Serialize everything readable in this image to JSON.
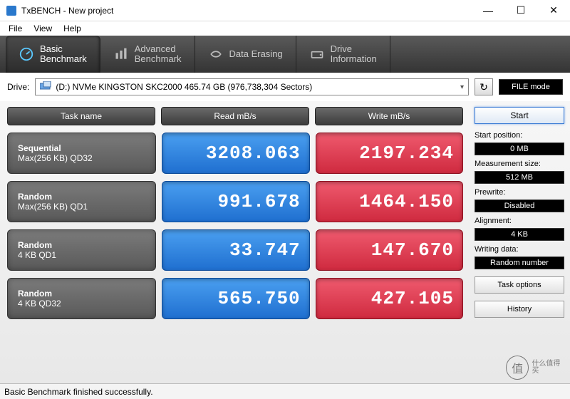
{
  "window": {
    "title": "TxBENCH - New project"
  },
  "menu": {
    "file": "File",
    "view": "View",
    "help": "Help"
  },
  "tabs": [
    {
      "label": "Basic\nBenchmark",
      "active": true
    },
    {
      "label": "Advanced\nBenchmark",
      "active": false
    },
    {
      "label": "Data Erasing",
      "active": false
    },
    {
      "label": "Drive\nInformation",
      "active": false
    }
  ],
  "drive": {
    "label": "Drive:",
    "selected": "(D:) NVMe KINGSTON SKC2000  465.74 GB  (976,738,304 Sectors)",
    "file_mode": "FILE mode"
  },
  "headers": {
    "task": "Task name",
    "read": "Read mB/s",
    "write": "Write mB/s"
  },
  "rows": [
    {
      "task1": "Sequential",
      "task2": "Max(256 KB) QD32",
      "read": "3208.063",
      "write": "2197.234"
    },
    {
      "task1": "Random",
      "task2": "Max(256 KB) QD1",
      "read": "991.678",
      "write": "1464.150"
    },
    {
      "task1": "Random",
      "task2": "4 KB QD1",
      "read": "33.747",
      "write": "147.670"
    },
    {
      "task1": "Random",
      "task2": "4 KB QD32",
      "read": "565.750",
      "write": "427.105"
    }
  ],
  "sidebar": {
    "start": "Start",
    "start_pos_label": "Start position:",
    "start_pos": "0 MB",
    "meas_size_label": "Measurement size:",
    "meas_size": "512 MB",
    "prewrite_label": "Prewrite:",
    "prewrite": "Disabled",
    "alignment_label": "Alignment:",
    "alignment": "4 KB",
    "writing_data_label": "Writing data:",
    "writing_data": "Random number",
    "task_options": "Task options",
    "history": "History"
  },
  "status": "Basic Benchmark finished successfully.",
  "watermark": {
    "char": "值",
    "text": "什么值得买"
  },
  "chart_data": {
    "type": "table",
    "title": "TxBENCH Basic Benchmark",
    "columns": [
      "Task name",
      "Read mB/s",
      "Write mB/s"
    ],
    "rows": [
      [
        "Sequential Max(256 KB) QD32",
        3208.063,
        2197.234
      ],
      [
        "Random Max(256 KB) QD1",
        991.678,
        1464.15
      ],
      [
        "Random 4 KB QD1",
        33.747,
        147.67
      ],
      [
        "Random 4 KB QD32",
        565.75,
        427.105
      ]
    ]
  }
}
